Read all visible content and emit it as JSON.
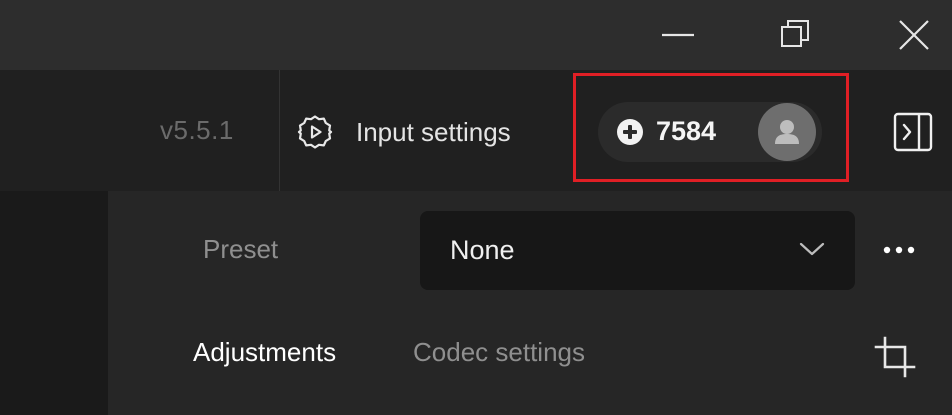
{
  "window": {
    "controls": [
      "minimize-icon",
      "restore-icon",
      "close-icon"
    ]
  },
  "toolbar": {
    "version": "v5.5.1",
    "input_settings_label": "Input settings",
    "input_settings_icon": "gear-play-icon",
    "credits": "7584",
    "credits_icon": "plus-circle-icon",
    "avatar_icon": "user-icon",
    "panel_toggle_icon": "sidebar-toggle-icon",
    "highlight_color": "#e01f25"
  },
  "settings": {
    "preset_label": "Preset",
    "preset_value": "None",
    "more_icon": "more-horizontal-icon",
    "tabs": [
      {
        "label": "Adjustments",
        "active": true
      },
      {
        "label": "Codec settings",
        "active": false
      }
    ],
    "crop_icon": "crop-icon"
  }
}
